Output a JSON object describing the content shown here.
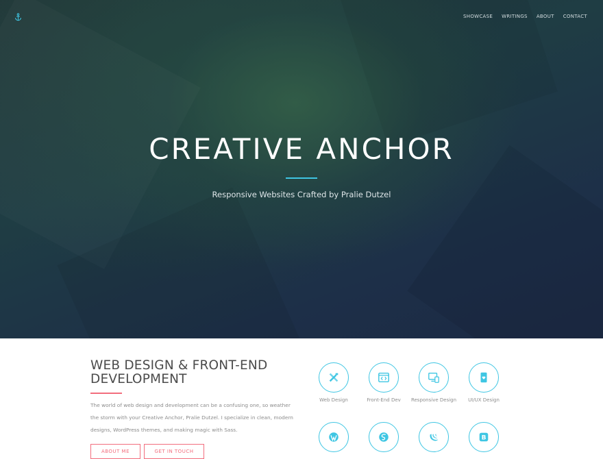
{
  "colors": {
    "accent_blue": "#3fc6e3",
    "accent_pink": "#f26d7d",
    "hero_bg": "#1f3d44",
    "heading_text": "#4b4b4b",
    "body_text": "#8b8b8b"
  },
  "header": {
    "logo_icon": "anchor-icon",
    "nav": [
      "SHOWCASE",
      "WRITINGS",
      "ABOUT",
      "CONTACT"
    ]
  },
  "hero": {
    "title": "CREATIVE ANCHOR",
    "subtitle": "Responsive Websites Crafted by Pralie Dutzel"
  },
  "intro": {
    "heading": "WEB DESIGN & FRONT-END DEVELOPMENT",
    "body": "The world of web design and development can be a confusing one, so weather the storm with your Creative Anchor, Pralie Dutzel. I specialize in clean, modern designs, WordPress themes, and making magic with Sass.",
    "about_button": "ABOUT ME",
    "contact_button": "GET IN TOUCH"
  },
  "skills": [
    {
      "label": "Web Design",
      "icon": "pencil-tools-icon"
    },
    {
      "label": "Front-End Dev",
      "icon": "code-window-icon"
    },
    {
      "label": "Responsive Design",
      "icon": "devices-icon"
    },
    {
      "label": "UI/UX Design",
      "icon": "phone-heart-icon"
    },
    {
      "label": "",
      "icon": "wordpress-icon"
    },
    {
      "label": "",
      "icon": "sass-icon"
    },
    {
      "label": "",
      "icon": "jquery-icon"
    },
    {
      "label": "",
      "icon": "bootstrap-icon"
    }
  ]
}
